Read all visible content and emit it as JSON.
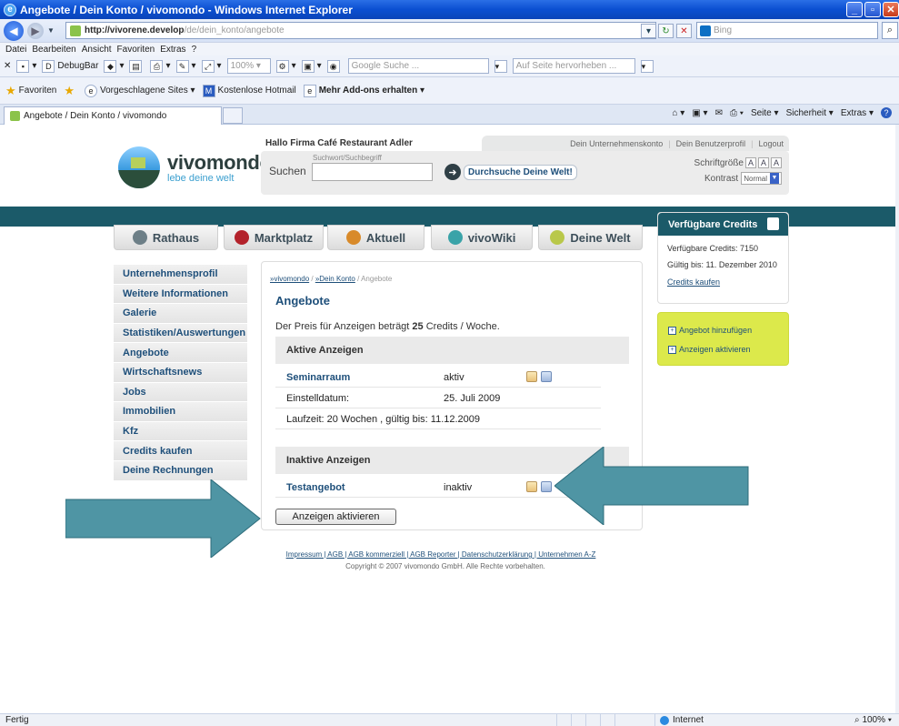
{
  "window": {
    "title": "Angebote / Dein Konto / vivomondo - Windows Internet Explorer"
  },
  "address": {
    "host": "http://vivorene.develop",
    "path": "/de/dein_konto/angebote"
  },
  "search": {
    "placeholder": "Bing"
  },
  "menubar": [
    "Datei",
    "Bearbeiten",
    "Ansicht",
    "Favoriten",
    "Extras",
    "?"
  ],
  "toolbar": {
    "debugbar": "DebugBar",
    "zoom": "100%",
    "google": "Google Suche ...",
    "highlight": "Auf Seite hervorheben ..."
  },
  "favbar": {
    "favorites": "Favoriten",
    "suggested": "Vorgeschlagene Sites",
    "hotmail": "Kostenlose Hotmail",
    "addons": "Mehr Add-ons erhalten"
  },
  "tab": {
    "title": "Angebote / Dein Konto / vivomondo"
  },
  "cmdbar": {
    "page": "Seite",
    "security": "Sicherheit",
    "extras": "Extras"
  },
  "site": {
    "brand": "vivomondo",
    "slogan": "lebe deine welt",
    "greeting": "Hallo Firma Café Restaurant Adler",
    "toplinks": [
      "Dein Unternehmenskonto",
      "Dein Benutzerprofil",
      "Logout"
    ],
    "search_label": "Suchen",
    "search_hint": "Suchwort/Suchbegriff",
    "search_button": "Durchsuche Deine Welt!",
    "fontsize_label": "Schriftgröße",
    "fontsize_buttons": [
      "A",
      "A",
      "A"
    ],
    "contrast_label": "Kontrast",
    "contrast_value": "Normal",
    "nav": [
      "Rathaus",
      "Marktplatz",
      "Aktuell",
      "vivoWiki",
      "Deine Welt"
    ],
    "sidebar": [
      "Unternehmensprofil",
      "Weitere Informationen",
      "Galerie",
      "Statistiken/Auswertungen",
      "Angebote",
      "Wirtschaftsnews",
      "Jobs",
      "Immobilien",
      "Kfz",
      "Credits kaufen",
      "Deine Rechnungen"
    ],
    "breadcrumb": {
      "a": "»vivomondo",
      "b": "»Dein Konto",
      "c": "/ Angebote"
    },
    "title": "Angebote",
    "price_pre": "Der Preis für Anzeigen beträgt ",
    "price_val": "25",
    "price_post": " Credits / Woche.",
    "active": {
      "header": "Aktive Anzeigen",
      "name": "Seminarraum",
      "status": "aktiv",
      "date_label": "Einstelldatum:",
      "date": "25. Juli 2009",
      "runtime": "Laufzeit: 20 Wochen , gültig bis: 11.12.2009"
    },
    "inactive": {
      "header": "Inaktive Anzeigen",
      "name": "Testangebot",
      "status": "inaktiv"
    },
    "activate_button": "Anzeigen aktivieren",
    "credits": {
      "header": "Verfügbare Credits",
      "available": "Verfügbare Credits: 7150",
      "valid": "Gültig bis: 11. Dezember 2010",
      "buy": "Credits kaufen"
    },
    "actions": [
      "Angebot hinzufügen",
      "Anzeigen aktivieren"
    ],
    "footer": {
      "links": "Impressum | AGB | AGB kommerziell | AGB Reporter | Datenschutzerklärung | Unternehmen A-Z",
      "copyright": "Copyright © 2007 vivomondo GmbH. Alle Rechte vorbehalten."
    }
  },
  "status": {
    "left": "Fertig",
    "zone": "Internet",
    "zoom": "100%"
  },
  "colors": {
    "teal": "#1b5a69",
    "link": "#1e4f7a",
    "lime": "#dce94b",
    "arrow": "#4f95a4"
  }
}
